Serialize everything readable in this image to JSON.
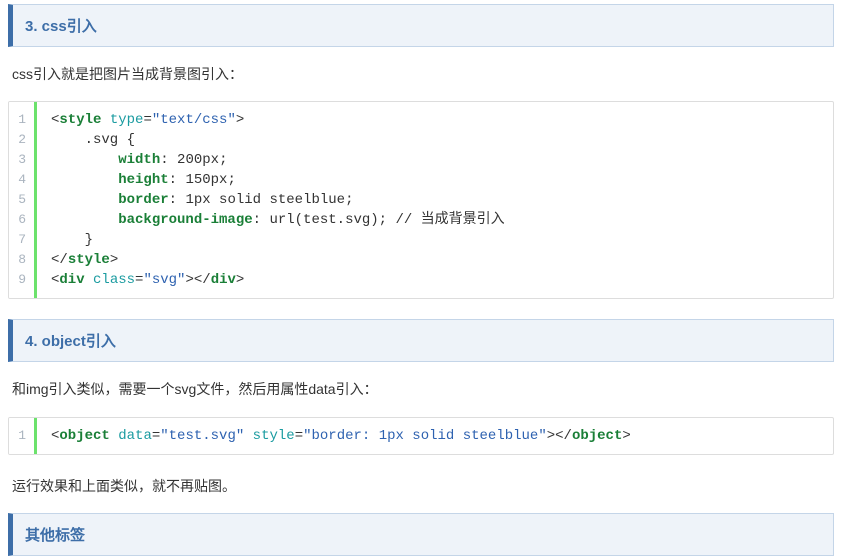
{
  "sections": {
    "css": {
      "title": "3. css引入",
      "intro": "css引入就是把图片当成背景图引入：",
      "code": {
        "lineNumbers": [
          "1",
          "2",
          "3",
          "4",
          "5",
          "6",
          "7",
          "8",
          "9"
        ],
        "tokens": [
          [
            {
              "t": "<",
              "c": "tok-punc"
            },
            {
              "t": "style",
              "c": "tok-tag"
            },
            {
              "t": " ",
              "c": ""
            },
            {
              "t": "type",
              "c": "tok-attr"
            },
            {
              "t": "=",
              "c": "tok-punc"
            },
            {
              "t": "\"text/css\"",
              "c": "tok-str"
            },
            {
              "t": ">",
              "c": "tok-punc"
            }
          ],
          [
            {
              "t": "    .svg {",
              "c": "tok-sel"
            }
          ],
          [
            {
              "t": "        ",
              "c": ""
            },
            {
              "t": "width",
              "c": "tok-prop"
            },
            {
              "t": ": ",
              "c": "tok-punc"
            },
            {
              "t": "200px",
              "c": "tok-val"
            },
            {
              "t": ";",
              "c": "tok-punc"
            }
          ],
          [
            {
              "t": "        ",
              "c": ""
            },
            {
              "t": "height",
              "c": "tok-prop"
            },
            {
              "t": ": ",
              "c": "tok-punc"
            },
            {
              "t": "150px",
              "c": "tok-val"
            },
            {
              "t": ";",
              "c": "tok-punc"
            }
          ],
          [
            {
              "t": "        ",
              "c": ""
            },
            {
              "t": "border",
              "c": "tok-prop"
            },
            {
              "t": ": ",
              "c": "tok-punc"
            },
            {
              "t": "1px solid steelblue",
              "c": "tok-val"
            },
            {
              "t": ";",
              "c": "tok-punc"
            }
          ],
          [
            {
              "t": "        ",
              "c": ""
            },
            {
              "t": "background-image",
              "c": "tok-prop"
            },
            {
              "t": ": ",
              "c": "tok-punc"
            },
            {
              "t": "url(test.svg)",
              "c": "tok-val"
            },
            {
              "t": "; // 当成背景引入",
              "c": "tok-comment"
            }
          ],
          [
            {
              "t": "    }",
              "c": "tok-sel"
            }
          ],
          [
            {
              "t": "</",
              "c": "tok-punc"
            },
            {
              "t": "style",
              "c": "tok-tag"
            },
            {
              "t": ">",
              "c": "tok-punc"
            }
          ],
          [
            {
              "t": "<",
              "c": "tok-punc"
            },
            {
              "t": "div",
              "c": "tok-tag"
            },
            {
              "t": " ",
              "c": ""
            },
            {
              "t": "class",
              "c": "tok-attr"
            },
            {
              "t": "=",
              "c": "tok-punc"
            },
            {
              "t": "\"svg\"",
              "c": "tok-str"
            },
            {
              "t": "></",
              "c": "tok-punc"
            },
            {
              "t": "div",
              "c": "tok-tag"
            },
            {
              "t": ">",
              "c": "tok-punc"
            }
          ]
        ]
      }
    },
    "object": {
      "title": "4. object引入",
      "intro": "和img引入类似，需要一个svg文件，然后用属性data引入：",
      "code": {
        "lineNumbers": [
          "1"
        ],
        "tokens": [
          [
            {
              "t": "<",
              "c": "tok-punc"
            },
            {
              "t": "object",
              "c": "tok-tag"
            },
            {
              "t": " ",
              "c": ""
            },
            {
              "t": "data",
              "c": "tok-attr"
            },
            {
              "t": "=",
              "c": "tok-punc"
            },
            {
              "t": "\"test.svg\"",
              "c": "tok-str"
            },
            {
              "t": " ",
              "c": ""
            },
            {
              "t": "style",
              "c": "tok-attr"
            },
            {
              "t": "=",
              "c": "tok-punc"
            },
            {
              "t": "\"border: 1px solid steelblue\"",
              "c": "tok-str"
            },
            {
              "t": "></",
              "c": "tok-punc"
            },
            {
              "t": "object",
              "c": "tok-tag"
            },
            {
              "t": ">",
              "c": "tok-punc"
            }
          ]
        ]
      },
      "outro": "运行效果和上面类似，就不再贴图。"
    },
    "other": {
      "title": "其他标签"
    }
  }
}
